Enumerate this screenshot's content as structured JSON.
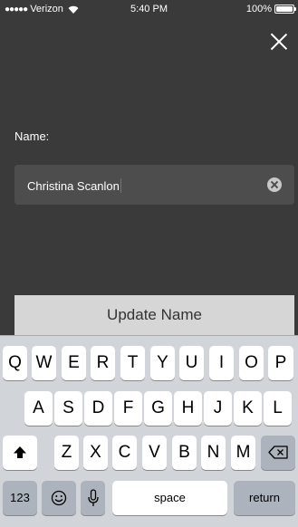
{
  "status_bar": {
    "signal_dots": "●●●●●",
    "carrier": "Verizon",
    "time": "5:40 PM",
    "battery_percent": "100%",
    "battery_level": 1.0
  },
  "form": {
    "label": "Name:",
    "value": "Christina Scanlon",
    "submit_label": "Update Name"
  },
  "keyboard": {
    "row1": [
      "Q",
      "W",
      "E",
      "R",
      "T",
      "Y",
      "U",
      "I",
      "O",
      "P"
    ],
    "row2": [
      "A",
      "S",
      "D",
      "F",
      "G",
      "H",
      "J",
      "K",
      "L"
    ],
    "row3": [
      "Z",
      "X",
      "C",
      "V",
      "B",
      "N",
      "M"
    ],
    "numbers_label": "123",
    "space_label": "space",
    "return_label": "return"
  },
  "icons": {
    "close": "close-icon",
    "clear": "clear-text-icon",
    "shift": "shift-icon",
    "delete": "delete-icon",
    "emoji": "emoji-icon",
    "mic": "microphone-icon",
    "wifi": "wifi-icon",
    "battery": "battery-icon"
  },
  "colors": {
    "background": "#3a3a3a",
    "field": "#4d4d4d",
    "button": "#d6d6d6",
    "keyboard": "#d1d4d9",
    "cursor": "#2f7df6"
  }
}
